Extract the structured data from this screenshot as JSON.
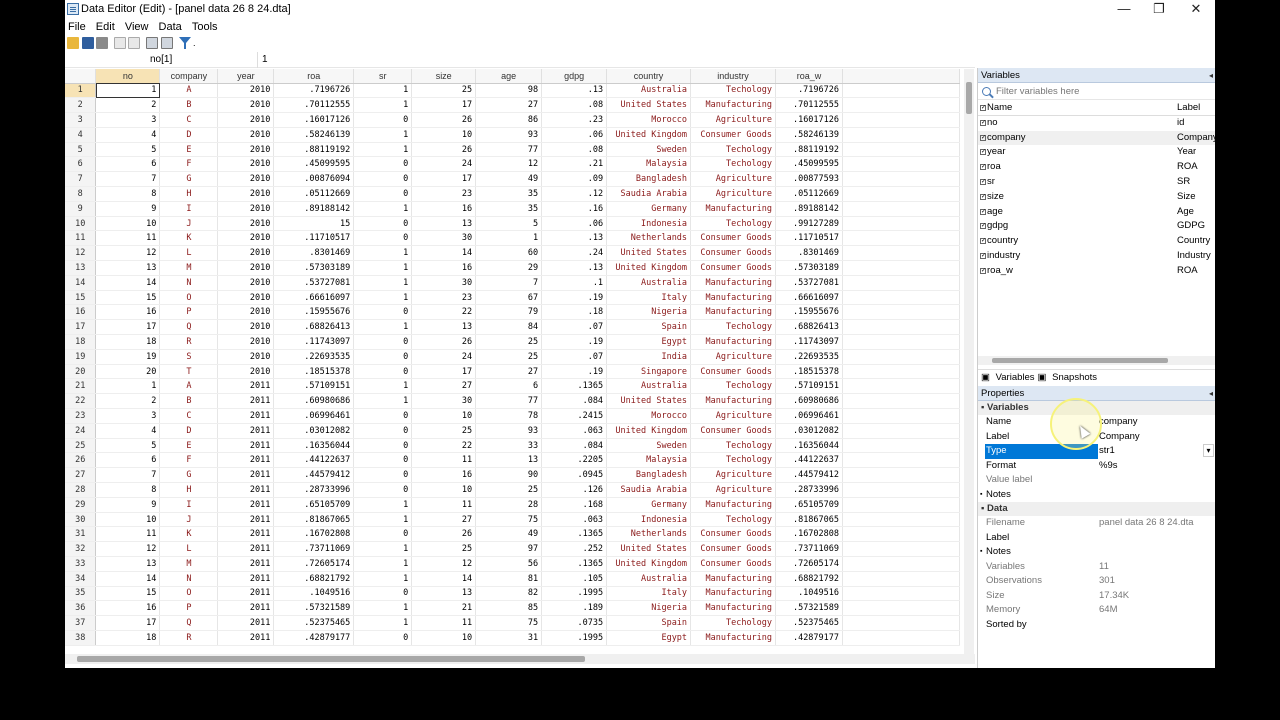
{
  "window": {
    "title": "Data Editor (Edit) - [panel data 26 8 24.dta]",
    "min_label": "—",
    "max_label": "❐",
    "close_label": "✕"
  },
  "menu": [
    "File",
    "Edit",
    "View",
    "Data",
    "Tools"
  ],
  "toolbar": {
    "filter_label": "."
  },
  "edit_row": {
    "cell_ref": "no[1]",
    "cell_value": "1"
  },
  "grid": {
    "columns": [
      "no",
      "company",
      "year",
      "roa",
      "sr",
      "size",
      "age",
      "gdpg",
      "country",
      "industry",
      "roa_w"
    ],
    "rows": [
      [
        "1",
        "A",
        "2010",
        ".7196726",
        "1",
        "25",
        "98",
        ".13",
        "Australia",
        "Techology",
        ".7196726"
      ],
      [
        "2",
        "B",
        "2010",
        ".70112555",
        "1",
        "17",
        "27",
        ".08",
        "United States",
        "Manufacturing",
        ".70112555"
      ],
      [
        "3",
        "C",
        "2010",
        ".16017126",
        "0",
        "26",
        "86",
        ".23",
        "Morocco",
        "Agriculture",
        ".16017126"
      ],
      [
        "4",
        "D",
        "2010",
        ".58246139",
        "1",
        "10",
        "93",
        ".06",
        "United Kingdom",
        "Consumer Goods",
        ".58246139"
      ],
      [
        "5",
        "E",
        "2010",
        ".88119192",
        "1",
        "26",
        "77",
        ".08",
        "Sweden",
        "Techology",
        ".88119192"
      ],
      [
        "6",
        "F",
        "2010",
        ".45099595",
        "0",
        "24",
        "12",
        ".21",
        "Malaysia",
        "Techology",
        ".45099595"
      ],
      [
        "7",
        "G",
        "2010",
        ".00876094",
        "0",
        "17",
        "49",
        ".09",
        "Bangladesh",
        "Agriculture",
        ".00877593"
      ],
      [
        "8",
        "H",
        "2010",
        ".05112669",
        "0",
        "23",
        "35",
        ".12",
        "Saudia Arabia",
        "Agriculture",
        ".05112669"
      ],
      [
        "9",
        "I",
        "2010",
        ".89188142",
        "1",
        "16",
        "35",
        ".16",
        "Germany",
        "Manufacturing",
        ".89188142"
      ],
      [
        "10",
        "J",
        "2010",
        "15",
        "0",
        "13",
        "5",
        ".06",
        "Indonesia",
        "Techology",
        ".99127289"
      ],
      [
        "11",
        "K",
        "2010",
        ".11710517",
        "0",
        "30",
        "1",
        ".13",
        "Netherlands",
        "Consumer Goods",
        ".11710517"
      ],
      [
        "12",
        "L",
        "2010",
        ".8301469",
        "1",
        "14",
        "60",
        ".24",
        "United States",
        "Consumer Goods",
        ".8301469"
      ],
      [
        "13",
        "M",
        "2010",
        ".57303189",
        "1",
        "16",
        "29",
        ".13",
        "United Kingdom",
        "Consumer Goods",
        ".57303189"
      ],
      [
        "14",
        "N",
        "2010",
        ".53727081",
        "1",
        "30",
        "7",
        ".1",
        "Australia",
        "Manufacturing",
        ".53727081"
      ],
      [
        "15",
        "O",
        "2010",
        ".66616097",
        "1",
        "23",
        "67",
        ".19",
        "Italy",
        "Manufacturing",
        ".66616097"
      ],
      [
        "16",
        "P",
        "2010",
        ".15955676",
        "0",
        "22",
        "79",
        ".18",
        "Nigeria",
        "Manufacturing",
        ".15955676"
      ],
      [
        "17",
        "Q",
        "2010",
        ".68826413",
        "1",
        "13",
        "84",
        ".07",
        "Spain",
        "Techology",
        ".68826413"
      ],
      [
        "18",
        "R",
        "2010",
        ".11743097",
        "0",
        "26",
        "25",
        ".19",
        "Egypt",
        "Manufacturing",
        ".11743097"
      ],
      [
        "19",
        "S",
        "2010",
        ".22693535",
        "0",
        "24",
        "25",
        ".07",
        "India",
        "Agriculture",
        ".22693535"
      ],
      [
        "20",
        "T",
        "2010",
        ".18515378",
        "0",
        "17",
        "27",
        ".19",
        "Singapore",
        "Consumer Goods",
        ".18515378"
      ],
      [
        "1",
        "A",
        "2011",
        ".57109151",
        "1",
        "27",
        "6",
        ".1365",
        "Australia",
        "Techology",
        ".57109151"
      ],
      [
        "2",
        "B",
        "2011",
        ".60980686",
        "1",
        "30",
        "77",
        ".084",
        "United States",
        "Manufacturing",
        ".60980686"
      ],
      [
        "3",
        "C",
        "2011",
        ".06996461",
        "0",
        "10",
        "78",
        ".2415",
        "Morocco",
        "Agriculture",
        ".06996461"
      ],
      [
        "4",
        "D",
        "2011",
        ".03012082",
        "0",
        "25",
        "93",
        ".063",
        "United Kingdom",
        "Consumer Goods",
        ".03012082"
      ],
      [
        "5",
        "E",
        "2011",
        ".16356044",
        "0",
        "22",
        "33",
        ".084",
        "Sweden",
        "Techology",
        ".16356044"
      ],
      [
        "6",
        "F",
        "2011",
        ".44122637",
        "0",
        "11",
        "13",
        ".2205",
        "Malaysia",
        "Techology",
        ".44122637"
      ],
      [
        "7",
        "G",
        "2011",
        ".44579412",
        "0",
        "16",
        "90",
        ".0945",
        "Bangladesh",
        "Agriculture",
        ".44579412"
      ],
      [
        "8",
        "H",
        "2011",
        ".28733996",
        "0",
        "10",
        "25",
        ".126",
        "Saudia Arabia",
        "Agriculture",
        ".28733996"
      ],
      [
        "9",
        "I",
        "2011",
        ".65105709",
        "1",
        "11",
        "28",
        ".168",
        "Germany",
        "Manufacturing",
        ".65105709"
      ],
      [
        "10",
        "J",
        "2011",
        ".81867065",
        "1",
        "27",
        "75",
        ".063",
        "Indonesia",
        "Techology",
        ".81867065"
      ],
      [
        "11",
        "K",
        "2011",
        ".16702808",
        "0",
        "26",
        "49",
        ".1365",
        "Netherlands",
        "Consumer Goods",
        ".16702808"
      ],
      [
        "12",
        "L",
        "2011",
        ".73711069",
        "1",
        "25",
        "97",
        ".252",
        "United States",
        "Consumer Goods",
        ".73711069"
      ],
      [
        "13",
        "M",
        "2011",
        ".72605174",
        "1",
        "12",
        "56",
        ".1365",
        "United Kingdom",
        "Consumer Goods",
        ".72605174"
      ],
      [
        "14",
        "N",
        "2011",
        ".68821792",
        "1",
        "14",
        "81",
        ".105",
        "Australia",
        "Manufacturing",
        ".68821792"
      ],
      [
        "15",
        "O",
        "2011",
        ".1049516",
        "0",
        "13",
        "82",
        ".1995",
        "Italy",
        "Manufacturing",
        ".1049516"
      ],
      [
        "16",
        "P",
        "2011",
        ".57321589",
        "1",
        "21",
        "85",
        ".189",
        "Nigeria",
        "Manufacturing",
        ".57321589"
      ],
      [
        "17",
        "Q",
        "2011",
        ".52375465",
        "1",
        "11",
        "75",
        ".0735",
        "Spain",
        "Techology",
        ".52375465"
      ],
      [
        "18",
        "R",
        "2011",
        ".42879177",
        "0",
        "10",
        "31",
        ".1995",
        "Egypt",
        "Manufacturing",
        ".42879177"
      ]
    ]
  },
  "variables_panel": {
    "title": "Variables",
    "search_placeholder": "Filter variables here",
    "header_name": "Name",
    "header_label": "Label",
    "items": [
      {
        "name": "no",
        "label": "id"
      },
      {
        "name": "company",
        "label": "Company"
      },
      {
        "name": "year",
        "label": "Year"
      },
      {
        "name": "roa",
        "label": "ROA"
      },
      {
        "name": "sr",
        "label": "SR"
      },
      {
        "name": "size",
        "label": "Size"
      },
      {
        "name": "age",
        "label": "Age"
      },
      {
        "name": "gdpg",
        "label": "GDPG"
      },
      {
        "name": "country",
        "label": "Country"
      },
      {
        "name": "industry",
        "label": "Industry"
      },
      {
        "name": "roa_w",
        "label": "ROA"
      }
    ],
    "tab_variables": "Variables",
    "tab_snapshots": "Snapshots"
  },
  "properties_panel": {
    "title": "Properties",
    "section_variables": "Variables",
    "name_key": "Name",
    "name_val": "company",
    "label_key": "Label",
    "label_val": "Company",
    "type_key": "Type",
    "type_val": "str1",
    "format_key": "Format",
    "format_val": "%9s",
    "value_label_key": "Value label",
    "notes_key": "Notes",
    "section_data": "Data",
    "filename_key": "Filename",
    "filename_val": "panel data 26 8 24.dta",
    "data_label_key": "Label",
    "data_notes_key": "Notes",
    "variables_key": "Variables",
    "variables_val": "11",
    "observations_key": "Observations",
    "observations_val": "301",
    "size_key": "Size",
    "size_val": "17.34K",
    "memory_key": "Memory",
    "memory_val": "64M",
    "sorted_key": "Sorted by"
  }
}
